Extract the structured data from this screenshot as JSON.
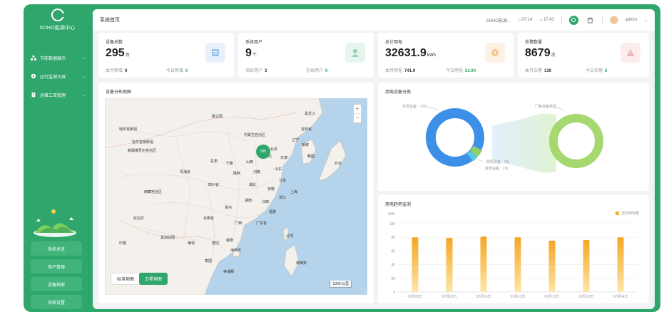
{
  "app": {
    "logo_text": "SOHO能源中心",
    "colors": {
      "brand": "#2fa66b",
      "brand_light": "#42b37b",
      "accent_orange": "#f5b335",
      "donut_blue": "#3d8fe8",
      "donut_green": "#a5d86f"
    }
  },
  "sidebar": {
    "menu": [
      {
        "label": "节能数据展示",
        "icon": "cluster-icon"
      },
      {
        "label": "运行监测大屏",
        "icon": "monitor-icon"
      },
      {
        "label": "运维工单管理",
        "icon": "workorder-icon"
      }
    ],
    "quick_buttons": [
      "系统总览",
      "用户管理",
      "设备档案",
      "系统设置"
    ]
  },
  "topbar": {
    "title": "系统首页",
    "site": "SOHO能源...",
    "stat1": "07:14",
    "stat2": "17:43",
    "user": "admin"
  },
  "stats": [
    {
      "label": "设备总数",
      "value": "295",
      "unit": "台",
      "sub1_label": "本月新增",
      "sub1_value": "0",
      "sub2_label": "今日新增",
      "sub2_value": "0",
      "icon": "device-icon",
      "badge_color": "#e8f1fb",
      "icon_color": "#9cc3ec"
    },
    {
      "label": "系统用户",
      "value": "9",
      "unit": "个",
      "sub1_label": "活跃用户",
      "sub1_value": "3",
      "sub2_label": "在线用户",
      "sub2_value": "0",
      "icon": "user-icon",
      "badge_color": "#e6f6ee",
      "icon_color": "#93d3b0"
    },
    {
      "label": "总计用电",
      "value": "32631.9",
      "unit": "kWh",
      "sub1_label": "本月用电",
      "sub1_value": "741.9",
      "sub2_label": "今日用电",
      "sub2_value": "52.94",
      "icon": "energy-icon",
      "badge_color": "#fdf1e4",
      "icon_color": "#f5c58f"
    },
    {
      "label": "告警数量",
      "value": "8679",
      "unit": "次",
      "sub1_label": "本月告警",
      "sub1_value": "130",
      "sub2_label": "今日告警",
      "sub2_value": "6",
      "icon": "alarm-icon",
      "badge_color": "#fdecec",
      "icon_color": "#f3a9a9"
    }
  ],
  "map_panel": {
    "title": "设备分布地图",
    "cluster_count": "295",
    "btn_normal": "标准地图",
    "btn_satellite": "卫星地图",
    "scale": "1000 公里",
    "labels": [
      "蒙古国",
      "哈萨克斯坦",
      "吉尔吉斯斯坦",
      "新疆维吾尔自治区",
      "内蒙古自治区",
      "甘肃",
      "青海省",
      "西藏自治区",
      "四川省",
      "云南省",
      "贵州",
      "广西",
      "广东省",
      "湖南",
      "湖北",
      "河南",
      "河北",
      "山东",
      "江苏",
      "浙江",
      "福建",
      "江西",
      "安徽",
      "陕西",
      "山西",
      "宁夏",
      "辽宁",
      "吉林省",
      "黑龙江",
      "北京",
      "天津",
      "上海",
      "台湾",
      "海南省",
      "越南",
      "老挝",
      "泰国",
      "缅甸",
      "印度",
      "尼泊尔",
      "孟加拉国",
      "柬埔寨",
      "菲律宾",
      "韩国",
      "日本",
      "朝鲜"
    ]
  },
  "donut_panel": {
    "title": "用电设备分类",
    "label_main": "空调设备：37%...",
    "label_right": "门禁设备类型...",
    "label_bottom1": "照明设备：2%",
    "label_bottom2": "其他设备：1%"
  },
  "bar_panel": {
    "title": "用电趋势监测",
    "unit": "kWh",
    "legend": "当日用电量"
  },
  "chart_data": {
    "type": "bar",
    "categories": [
      "02月08日",
      "02月09日",
      "02月10日",
      "02月11日",
      "02月12日",
      "02月13日",
      "02月14日"
    ],
    "series": [
      {
        "name": "当日用电量",
        "values": [
          80,
          79,
          81,
          80,
          75,
          76,
          80
        ]
      }
    ],
    "ylabel": "kWh",
    "ylim": [
      0,
      100
    ],
    "yticks": [
      0,
      20,
      40,
      60,
      80,
      100
    ],
    "grid": true,
    "legend_position": "top-right"
  }
}
